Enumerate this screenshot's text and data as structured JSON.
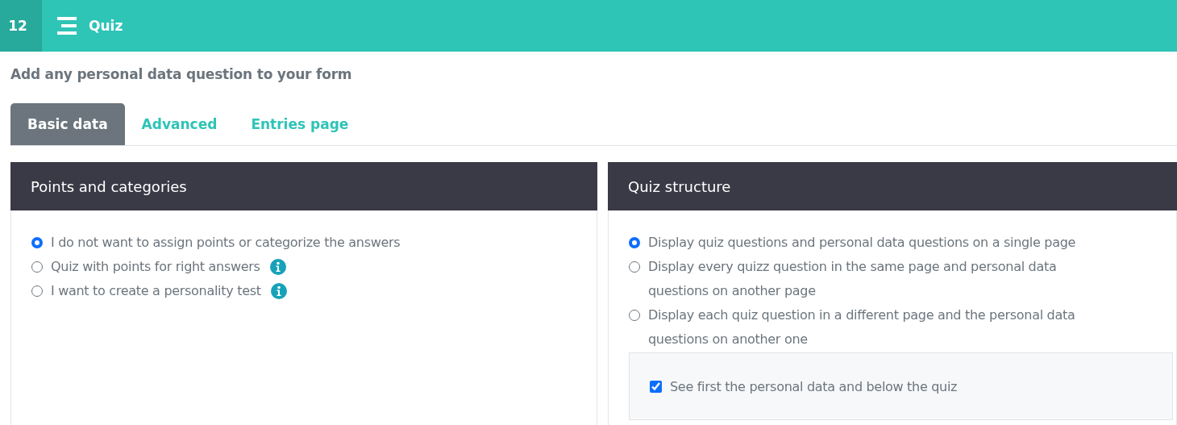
{
  "header": {
    "step": "12",
    "title": "Quiz"
  },
  "subtitle": "Add any personal data question to your form",
  "tabs": [
    {
      "label": "Basic data",
      "selected": true
    },
    {
      "label": "Advanced",
      "selected": false
    },
    {
      "label": "Entries page",
      "selected": false
    }
  ],
  "panels": [
    {
      "title": "Points and categories",
      "options": [
        {
          "label": "I do not want to assign points or categorize the answers",
          "selected": true,
          "info": false
        },
        {
          "label": "Quiz with points for right answers",
          "selected": false,
          "info": true
        },
        {
          "label": "I want to create a personality test",
          "selected": false,
          "info": true
        }
      ]
    },
    {
      "title": "Quiz structure",
      "options": [
        {
          "label": "Display quiz questions and personal data questions on a single page",
          "selected": true,
          "info": false
        },
        {
          "label": "Display every quizz question in the same page and personal data questions on another page",
          "selected": false,
          "info": false
        },
        {
          "label": "Display each quiz question in a different page and the personal data questions on another one",
          "selected": false,
          "info": false
        }
      ],
      "suboption": {
        "label": "See first the personal data and below the quiz",
        "checked": true
      }
    }
  ]
}
